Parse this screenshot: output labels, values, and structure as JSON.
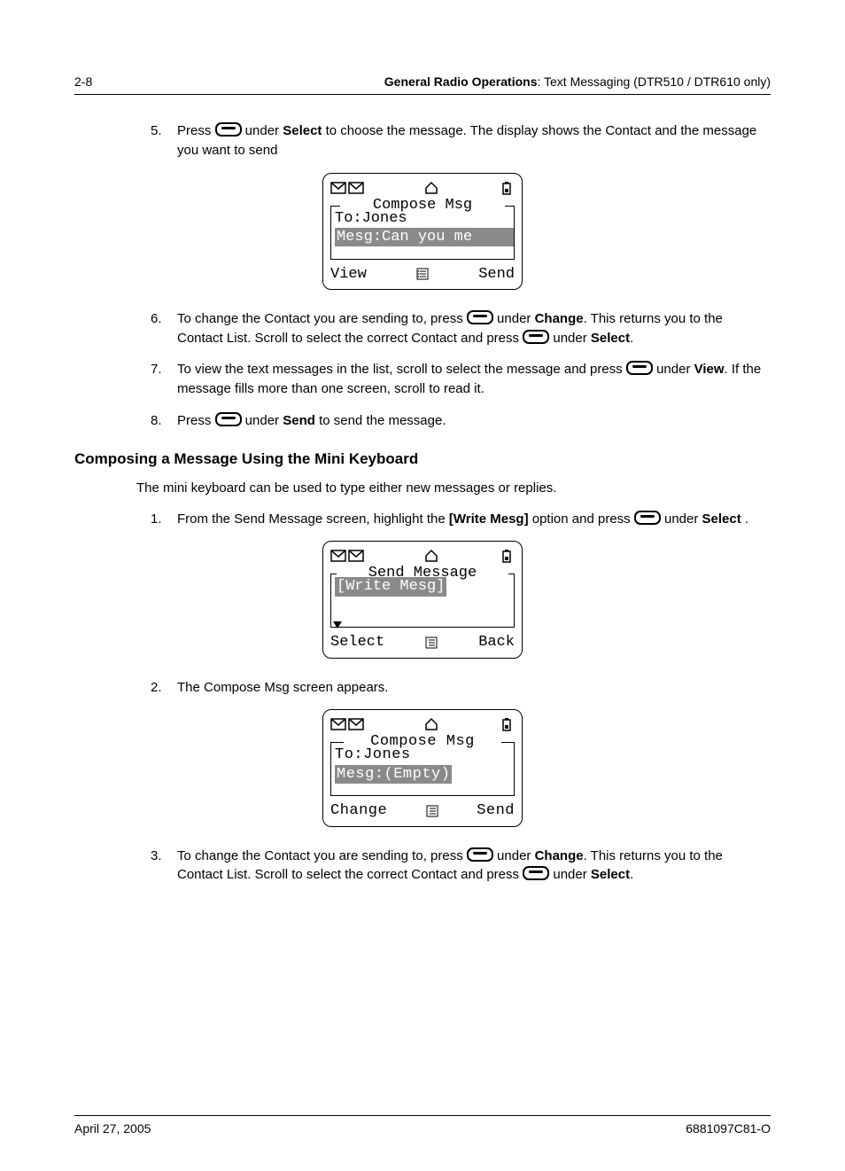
{
  "header": {
    "pageNum": "2-8",
    "title": "General Radio Operations",
    "subtitle": ": Text Messaging (DTR510 / DTR610 only)"
  },
  "steps_a": {
    "s5": {
      "num": "5.",
      "t1": "Press ",
      "t2": " under ",
      "b1": "Select",
      "t3": " to choose the message. The display shows the Contact and the message you want to send"
    },
    "s6": {
      "num": "6.",
      "t1": "To change the Contact you are sending to, press ",
      "t2": " under ",
      "b1": "Change",
      "t3": ". This returns you to the Contact List. Scroll to select the correct Contact and press ",
      "t4": " under ",
      "b2": "Select",
      "t5": "."
    },
    "s7": {
      "num": "7.",
      "t1": "To view the text messages in the list, scroll to select the message and press ",
      "t2": " under ",
      "b1": "View",
      "t3": ". If the message fills more than one screen, scroll to read it."
    },
    "s8": {
      "num": "8.",
      "t1": "Press ",
      "t2": " under ",
      "b1": "Send",
      "t3": " to send the message."
    }
  },
  "heading2": "Composing a Message Using the Mini Keyboard",
  "intro2": "The mini keyboard can be used to type either new messages or replies.",
  "steps_b": {
    "s1": {
      "num": "1.",
      "t1": "From the Send Message screen, highlight the ",
      "b1": "[Write Mesg]",
      "t2": " option and press ",
      "t3": " under ",
      "b2": "Select",
      "t4": " ."
    },
    "s2": {
      "num": "2.",
      "t1": "The Compose Msg screen appears."
    },
    "s3": {
      "num": "3.",
      "t1": "To change the Contact you are sending to, press ",
      "t2": " under ",
      "b1": "Change",
      "t3": ". This returns you to the Contact List. Scroll to select the correct Contact and press ",
      "t4": " under ",
      "b2": "Select",
      "t5": "."
    }
  },
  "screen1": {
    "title": "Compose Msg",
    "line1": "To:Jones",
    "line2": "Mesg:Can you me",
    "left": "View",
    "right": "Send"
  },
  "screen2": {
    "title": "Send Message",
    "line1": "[Write Mesg]",
    "left": "Select",
    "right": "Back"
  },
  "screen3": {
    "title": "Compose Msg",
    "line1": "To:Jones",
    "line2": "Mesg:(Empty)",
    "left": "Change",
    "right": "Send"
  },
  "footer": {
    "date": "April 27, 2005",
    "docnum": "6881097C81-O"
  }
}
